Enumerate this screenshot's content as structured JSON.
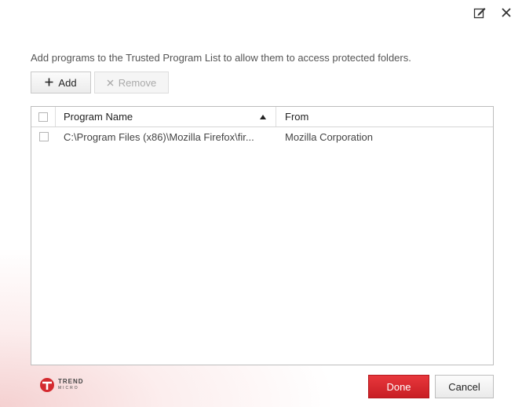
{
  "header": {
    "edit_icon": "edit-note-icon",
    "close_icon": "close-icon"
  },
  "instruction": "Add programs to the Trusted Program List to allow them to access protected folders.",
  "toolbar": {
    "add_label": "Add",
    "add_icon": "plus-icon",
    "remove_label": "Remove",
    "remove_icon": "x-icon"
  },
  "table": {
    "columns": [
      "Program Name",
      "From"
    ],
    "sort": {
      "column": "Program Name",
      "direction": "ascending"
    },
    "rows": [
      {
        "program": "C:\\Program Files (x86)\\Mozilla Firefox\\fir...",
        "from": "Mozilla Corporation",
        "checked": false
      }
    ]
  },
  "footer": {
    "logo": "TREND MICRO",
    "done_label": "Done",
    "cancel_label": "Cancel"
  },
  "colors": {
    "accent": "#d42a2f"
  }
}
